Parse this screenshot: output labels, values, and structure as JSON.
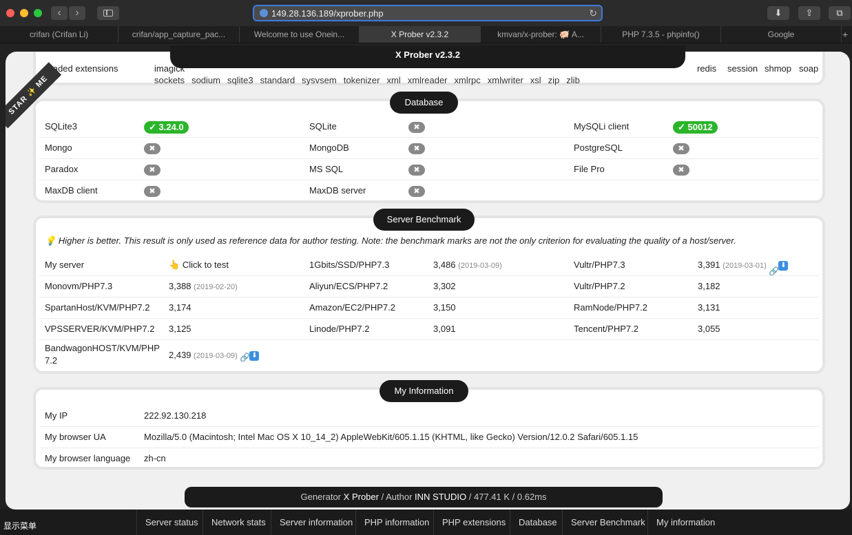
{
  "browser": {
    "url": "149.28.136.189/xprober.php",
    "tabs": [
      {
        "label": "crifan (Crifan Li)"
      },
      {
        "label": "crifan/app_capture_pac..."
      },
      {
        "label": "Welcome to use Onein..."
      },
      {
        "label": "X Prober v2.3.2"
      },
      {
        "label": "kmvan/x-prober: 🐖 A..."
      },
      {
        "label": "PHP 7.3.5 - phpinfo()"
      },
      {
        "label": "Google"
      }
    ],
    "plus": "+",
    "back": "‹",
    "forward": "›",
    "reload_icon": "↻",
    "download_icon": "⬇",
    "share_icon": "⇪",
    "tabs_icon": "⧉"
  },
  "page": {
    "banner_title": "X Prober v2.3.2",
    "ribbon": "STAR ✨ ME",
    "extensions": {
      "label": "...aded extensions",
      "top_partial": [
        "imagick"
      ],
      "top_right": [
        "redis",
        "session",
        "shmop",
        "soap"
      ],
      "second_row": [
        "sockets",
        "sodium",
        "sqlite3",
        "standard",
        "sysvsem",
        "tokenizer",
        "xml",
        "xmlreader",
        "xmlrpc",
        "xmlwriter",
        "xsl",
        "zip",
        "zlib"
      ]
    },
    "database": {
      "title": "Database",
      "rows": [
        [
          {
            "label": "SQLite3",
            "ok": "✓ 3.24.0"
          },
          {
            "label": "SQLite",
            "x": "✖"
          },
          {
            "label": "MySQLi client",
            "ok": "✓ 50012"
          }
        ],
        [
          {
            "label": "Mongo",
            "x": "✖"
          },
          {
            "label": "MongoDB",
            "x": "✖"
          },
          {
            "label": "PostgreSQL",
            "x": "✖"
          }
        ],
        [
          {
            "label": "Paradox",
            "x": "✖"
          },
          {
            "label": "MS SQL",
            "x": "✖"
          },
          {
            "label": "File Pro",
            "x": "✖"
          }
        ],
        [
          {
            "label": "MaxDB client",
            "x": "✖"
          },
          {
            "label": "MaxDB server",
            "x": "✖"
          }
        ]
      ]
    },
    "benchmark": {
      "title": "Server Benchmark",
      "note_icon": "💡",
      "note": "Higher is better. This result is only used as reference data for author testing. Note: the benchmark marks are not the only criterion for evaluating the quality of a host/server.",
      "my_server_label": "My server",
      "click_icon": "👆",
      "click_label": "Click to test",
      "items": [
        {
          "label": "1Gbits/SSD/PHP7.3",
          "score": "3,486",
          "date": "(2019-03-09)"
        },
        {
          "label": "Vultr/PHP7.3",
          "score": "3,391",
          "date": "(2019-03-01)",
          "icons": true
        },
        {
          "label": "Monovm/PHP7.3",
          "score": "3,388",
          "date": "(2019-02-20)"
        },
        {
          "label": "Aliyun/ECS/PHP7.2",
          "score": "3,302"
        },
        {
          "label": "Vultr/PHP7.2",
          "score": "3,182"
        },
        {
          "label": "SpartanHost/KVM/PHP7.2",
          "score": "3,174"
        },
        {
          "label": "Amazon/EC2/PHP7.2",
          "score": "3,150"
        },
        {
          "label": "RamNode/PHP7.2",
          "score": "3,131"
        },
        {
          "label": "VPSSERVER/KVM/PHP7.2",
          "score": "3,125"
        },
        {
          "label": "Linode/PHP7.2",
          "score": "3,091"
        },
        {
          "label": "Tencent/PHP7.2",
          "score": "3,055"
        },
        {
          "label": "BandwagonHOST/KVM/PHP 7.2",
          "score": "2,439",
          "date": "(2019-03-09)",
          "icons": true
        }
      ],
      "link_icon": "🔗",
      "dl_icon": "⬇"
    },
    "myinfo": {
      "title": "My Information",
      "rows": [
        {
          "label": "My IP",
          "value": "222.92.130.218"
        },
        {
          "label": "My browser UA",
          "value": "Mozilla/5.0 (Macintosh; Intel Mac OS X 10_14_2) AppleWebKit/605.1.15 (KHTML, like Gecko) Version/12.0.2 Safari/605.1.15"
        },
        {
          "label": "My browser language",
          "value": "zh-cn"
        }
      ]
    },
    "footer": {
      "generator": "Generator",
      "generator_name": "X Prober",
      "sep1": "/ Author",
      "author": "INN STUDIO",
      "stats": "/ 477.41 K / 0.62ms"
    }
  },
  "bottom_nav": {
    "menu": "显示菜单",
    "items": [
      "Server status",
      "Network stats",
      "Server information",
      "PHP information",
      "PHP extensions",
      "Database",
      "Server Benchmark",
      "My information"
    ]
  }
}
